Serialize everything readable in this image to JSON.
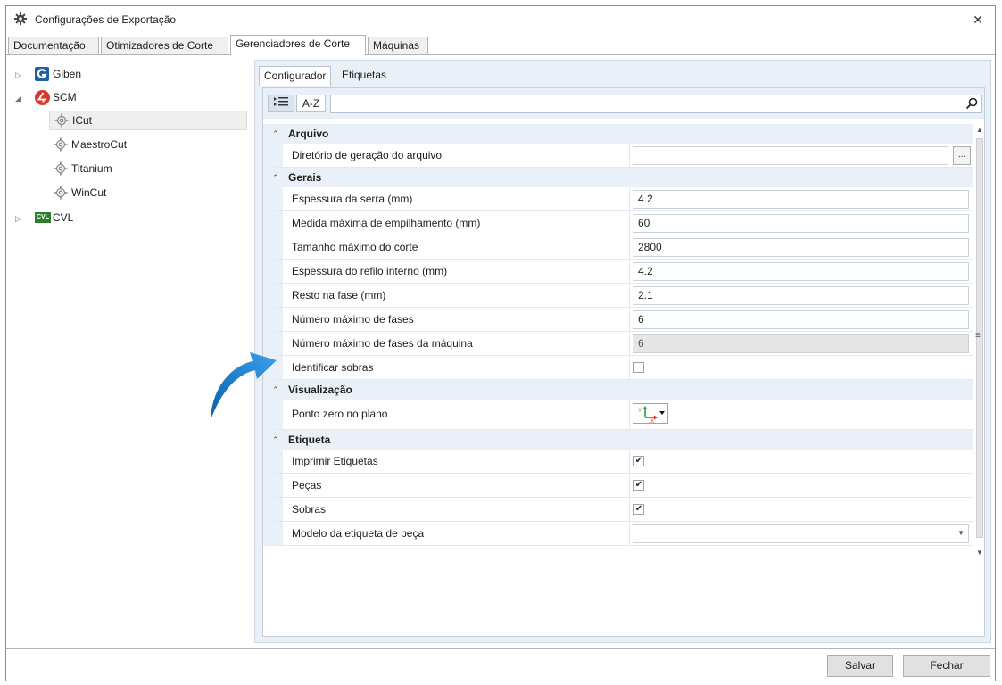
{
  "window": {
    "title": "Configurações de Exportação",
    "close_glyph": "✕"
  },
  "top_tabs": [
    {
      "label": "Documentação"
    },
    {
      "label": "Otimizadores de Corte"
    },
    {
      "label": "Gerenciadores de Corte",
      "active": true
    },
    {
      "label": "Máquinas"
    }
  ],
  "tree": [
    {
      "label": "Giben",
      "icon": "giben-logo-icon",
      "expanded": false
    },
    {
      "label": "SCM",
      "icon": "scm-logo-icon",
      "expanded": true,
      "children": [
        {
          "label": "ICut",
          "selected": true
        },
        {
          "label": "MaestroCut"
        },
        {
          "label": "Titanium"
        },
        {
          "label": "WinCut"
        }
      ]
    },
    {
      "label": "CVL",
      "icon": "cvl-logo-icon",
      "badge": "CVL",
      "expanded": false
    }
  ],
  "sub_tabs": [
    {
      "label": "Configurador",
      "active": true
    },
    {
      "label": "Etiquetas"
    }
  ],
  "toolbar": {
    "categorized_icon": "categorized-list-icon",
    "az_label": "A-Z",
    "search_placeholder": ""
  },
  "categories": [
    {
      "name": "Arquivo",
      "rows": [
        {
          "label": "Diretório de geração do arquivo",
          "type": "path",
          "value": "",
          "browse_label": "..."
        }
      ]
    },
    {
      "name": "Gerais",
      "rows": [
        {
          "label": "Espessura da serra (mm)",
          "type": "text",
          "value": "4.2"
        },
        {
          "label": "Medida máxima de empilhamento (mm)",
          "type": "text",
          "value": "60"
        },
        {
          "label": "Tamanho máximo do corte",
          "type": "text",
          "value": "2800"
        },
        {
          "label": "Espessura do refilo interno (mm)",
          "type": "text",
          "value": "4.2"
        },
        {
          "label": "Resto na fase (mm)",
          "type": "text",
          "value": "2.1"
        },
        {
          "label": "Número máximo de fases",
          "type": "text",
          "value": "6"
        },
        {
          "label": "Número máximo de fases da máquina",
          "type": "readonly",
          "value": "6"
        },
        {
          "label": "Identificar sobras",
          "type": "checkbox",
          "checked": false
        }
      ]
    },
    {
      "name": "Visualização",
      "rows": [
        {
          "label": "Ponto zero no plano",
          "type": "origin-picker",
          "axis_y": "Y",
          "axis_x": "X"
        }
      ]
    },
    {
      "name": "Etiqueta",
      "rows": [
        {
          "label": "Imprimir Etiquetas",
          "type": "checkbox",
          "checked": true
        },
        {
          "label": "Peças",
          "type": "checkbox",
          "checked": true
        },
        {
          "label": "Sobras",
          "type": "checkbox",
          "checked": true
        },
        {
          "label": "Modelo da etiqueta de peça",
          "type": "combo",
          "value": ""
        }
      ]
    }
  ],
  "buttons": {
    "save": "Salvar",
    "close": "Fechar"
  },
  "colors": {
    "accent_arrow": "#1e88d8",
    "category_bg": "#e9f0f7",
    "scm_red": "#d63a2a",
    "giben_blue": "#1f5fa8",
    "cvl_green": "#2f7d2f"
  }
}
